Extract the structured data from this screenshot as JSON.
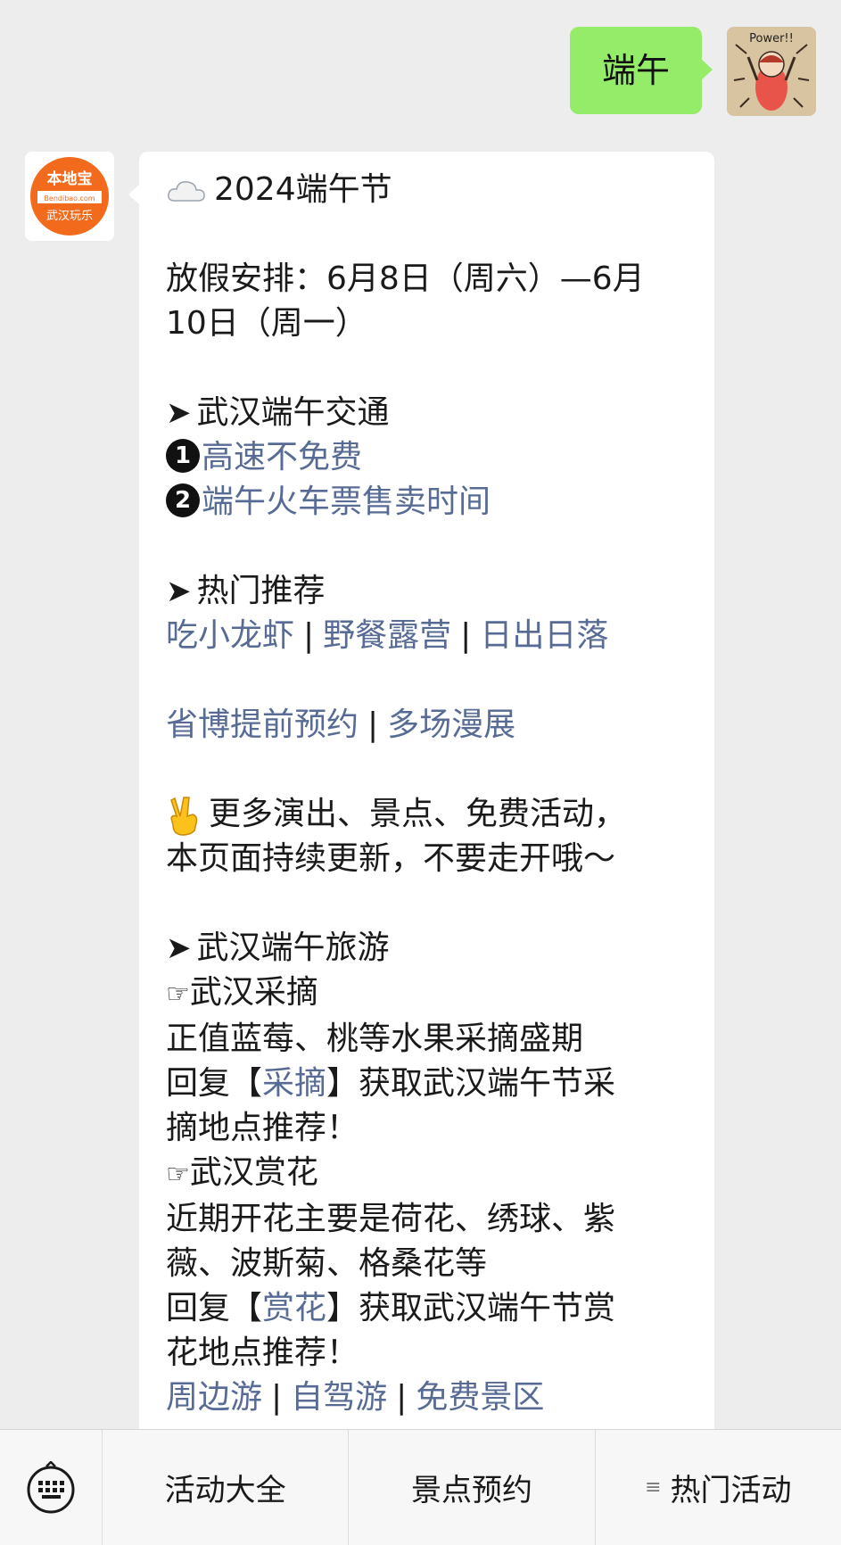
{
  "outgoing": {
    "text": "端午"
  },
  "incoming": {
    "title": "2024端午节",
    "holiday_line1": "放假安排：6月8日（周六）—6月",
    "holiday_line2": "10日（周一）",
    "traffic_heading": "武汉端午交通",
    "traffic_items": [
      {
        "num": "1",
        "label": "高速不免费"
      },
      {
        "num": "2",
        "label": "端午火车票售卖时间"
      }
    ],
    "hot_heading": "热门推荐",
    "hot_links_1": [
      "吃小龙虾",
      "野餐露营",
      "日出日落"
    ],
    "hot_links_2": [
      "省博提前预约",
      "多场漫展"
    ],
    "more_line1": "更多演出、景点、免费活动，",
    "more_line2": "本页面持续更新，不要走开哦～",
    "travel_heading": "武汉端午旅游",
    "picking": {
      "title": "武汉采摘",
      "desc": "正值蓝莓、桃等水果采摘盛期",
      "reply_prefix": "回复【",
      "reply_keyword": "采摘",
      "reply_suffix": "】获取武汉端午节采",
      "reply_line2": "摘地点推荐！"
    },
    "flowers": {
      "title": "武汉赏花",
      "desc_line1": "近期开花主要是荷花、绣球、紫",
      "desc_line2": "薇、波斯菊、格桑花等",
      "reply_prefix": "回复【",
      "reply_keyword": "赏花",
      "reply_suffix": "】获取武汉端午节赏",
      "reply_line2": "花地点推荐！"
    },
    "trip_links": [
      "周边游",
      "自驾游",
      "免费景区"
    ],
    "separator": "|"
  },
  "avatar_logo": {
    "brand": "本地宝",
    "domain": "Bendibao.com",
    "sub": "武汉玩乐"
  },
  "user_avatar_text": "Power!!",
  "menu": {
    "items": [
      "活动大全",
      "景点预约",
      "热门活动"
    ]
  },
  "colors": {
    "outgoing_bubble": "#95ec69",
    "link": "#576b95",
    "brand_orange": "#f26b1d",
    "background": "#ededed"
  }
}
